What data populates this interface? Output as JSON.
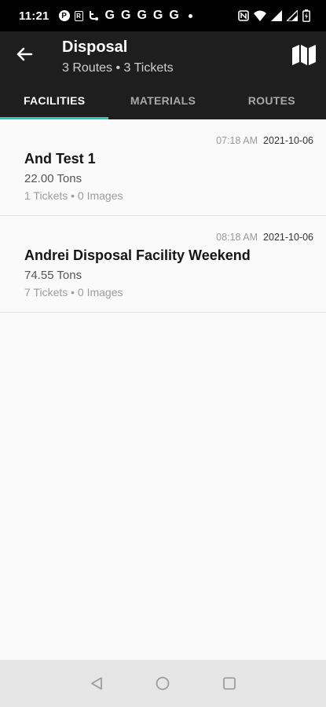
{
  "status_bar": {
    "time": "11:21",
    "notification_icons": [
      "p-icon",
      "r-icon",
      "fork-icon",
      "g-icon",
      "g-icon",
      "g-icon",
      "g-icon",
      "g-icon"
    ],
    "system_icons": [
      "nfc-icon",
      "wifi-icon",
      "signal-icon",
      "signal-icon",
      "battery-icon"
    ]
  },
  "header": {
    "title": "Disposal",
    "subtitle": "3 Routes • 3 Tickets",
    "back_icon": "arrow-left-icon",
    "map_icon": "map-icon"
  },
  "tabs": [
    {
      "label": "FACILITIES",
      "active": true
    },
    {
      "label": "MATERIALS",
      "active": false
    },
    {
      "label": "ROUTES",
      "active": false
    }
  ],
  "accent_color": "#2ec7b4",
  "facilities": [
    {
      "time": "07:18 AM",
      "date": "2021-10-06",
      "name": "And Test 1",
      "weight": "22.00 Tons",
      "meta": "1 Tickets • 0 Images"
    },
    {
      "time": "08:18 AM",
      "date": "2021-10-06",
      "name": "Andrei Disposal Facility Weekend",
      "weight": "74.55 Tons",
      "meta": "7 Tickets • 0 Images"
    }
  ],
  "nav_bar": {
    "buttons": [
      "back-triangle-icon",
      "home-circle-icon",
      "recents-square-icon"
    ]
  }
}
